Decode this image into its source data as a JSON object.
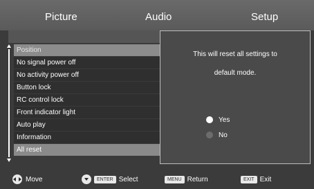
{
  "tabs": [
    {
      "label": "Picture"
    },
    {
      "label": "Audio"
    },
    {
      "label": "Setup"
    }
  ],
  "menu": {
    "items": [
      {
        "label": "Position"
      },
      {
        "label": "No signal power off"
      },
      {
        "label": "No activity power off"
      },
      {
        "label": "Button lock"
      },
      {
        "label": "RC control lock"
      },
      {
        "label": "Front indicator light"
      },
      {
        "label": "Auto play"
      },
      {
        "label": "Information"
      },
      {
        "label": "All reset"
      }
    ]
  },
  "dialog": {
    "line1": "This will reset all settings to",
    "line2": "default mode.",
    "options": [
      {
        "label": "Yes",
        "selected": true
      },
      {
        "label": "No",
        "selected": false
      }
    ]
  },
  "footer": {
    "move_label": "Move",
    "enter_key": "ENTER",
    "select_label": "Select",
    "menu_key": "MENU",
    "return_label": "Return",
    "exit_key": "EXIT",
    "exit_label": "Exit"
  },
  "icons": {
    "move": "dpad-left-right-icon",
    "select": "ok-button-icon",
    "scroll": "scroll-arrows-icon"
  },
  "colors": {
    "background": "#3b3b3b",
    "selected_row": "#8a8a8a",
    "dialog_bg": "#4a4a4a"
  }
}
